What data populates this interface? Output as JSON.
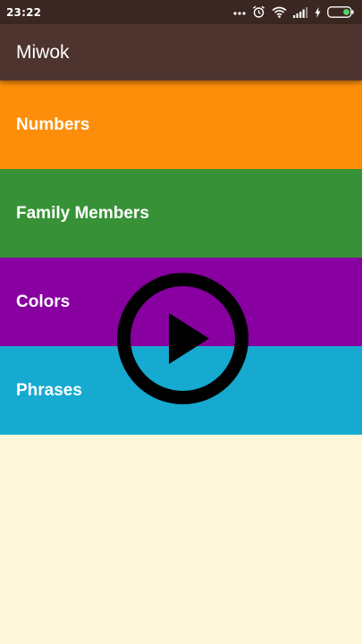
{
  "status_bar": {
    "time": "23:22",
    "icons": [
      "more-dots-icon",
      "alarm-icon",
      "wifi-icon",
      "signal-icon",
      "charging-icon",
      "battery-icon"
    ],
    "background": "#3A2722"
  },
  "app_bar": {
    "title": "Miwok",
    "background": "#4E342E"
  },
  "categories": [
    {
      "label": "Numbers",
      "color": "#FD8E09"
    },
    {
      "label": "Family Members",
      "color": "#379237"
    },
    {
      "label": "Colors",
      "color": "#8800A0"
    },
    {
      "label": "Phrases",
      "color": "#16AAD1"
    }
  ],
  "overlay": {
    "icon": "play-icon"
  },
  "page_background": "#FFF7DA"
}
